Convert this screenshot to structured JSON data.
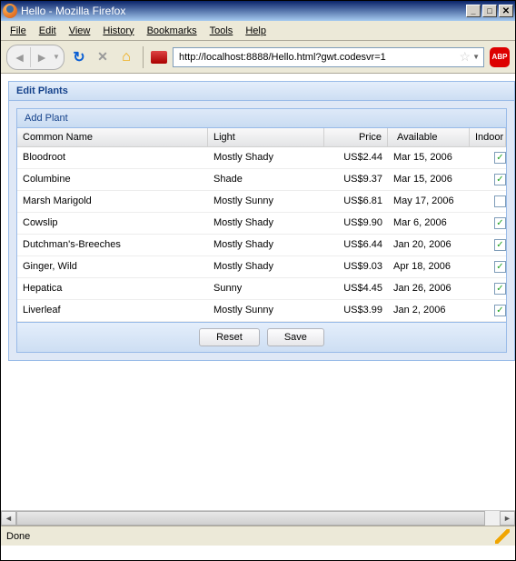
{
  "window": {
    "title": "Hello - Mozilla Firefox"
  },
  "menu": {
    "file": "File",
    "edit": "Edit",
    "view": "View",
    "history": "History",
    "bookmarks": "Bookmarks",
    "tools": "Tools",
    "help": "Help"
  },
  "toolbar": {
    "url": "http://localhost:8888/Hello.html?gwt.codesvr=1",
    "abp": "ABP"
  },
  "panel": {
    "title": "Edit Plants",
    "add_button": "Add Plant"
  },
  "grid": {
    "columns": {
      "name": "Common Name",
      "light": "Light",
      "price": "Price",
      "available": "Available",
      "indoor": "Indoor"
    },
    "rows": [
      {
        "name": "Bloodroot",
        "light": "Mostly Shady",
        "price": "US$2.44",
        "available": "Mar 15, 2006",
        "indoor": true
      },
      {
        "name": "Columbine",
        "light": "Shade",
        "price": "US$9.37",
        "available": "Mar 15, 2006",
        "indoor": true
      },
      {
        "name": "Marsh Marigold",
        "light": "Mostly Sunny",
        "price": "US$6.81",
        "available": "May 17, 2006",
        "indoor": false
      },
      {
        "name": "Cowslip",
        "light": "Mostly Shady",
        "price": "US$9.90",
        "available": "Mar 6, 2006",
        "indoor": true
      },
      {
        "name": "Dutchman's-Breeches",
        "light": "Mostly Shady",
        "price": "US$6.44",
        "available": "Jan 20, 2006",
        "indoor": true
      },
      {
        "name": "Ginger, Wild",
        "light": "Mostly Shady",
        "price": "US$9.03",
        "available": "Apr 18, 2006",
        "indoor": true
      },
      {
        "name": "Hepatica",
        "light": "Sunny",
        "price": "US$4.45",
        "available": "Jan 26, 2006",
        "indoor": true
      },
      {
        "name": "Liverleaf",
        "light": "Mostly Sunny",
        "price": "US$3.99",
        "available": "Jan 2, 2006",
        "indoor": true
      }
    ],
    "reset_button": "Reset",
    "save_button": "Save"
  },
  "status": {
    "text": "Done"
  }
}
